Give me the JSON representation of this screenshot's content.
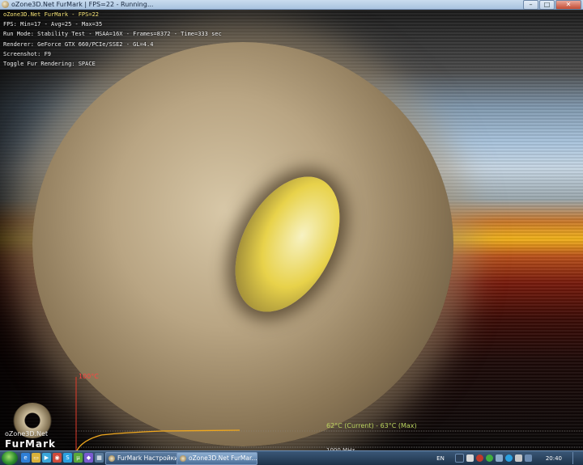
{
  "window": {
    "title": "oZone3D.Net FurMark | FPS=22 - Running...",
    "buttons": {
      "minimize": "–",
      "maximize": "□",
      "close": "✕"
    }
  },
  "stats": {
    "line1": "oZone3D.Net FurMark - FPS=22",
    "line2": "FPS: Min=17 - Avg=25 - Max=35",
    "line3": "Run Mode: Stability Test - MSAA=16X - Frames=8372 - Time=333 sec",
    "line4": "Renderer: GeForce GTX 660/PCIe/SSE2 - GL=4.4",
    "line5": "Screenshot: F9",
    "line6": "Toggle Fur Rendering: SPACE"
  },
  "temperature": {
    "axis_label": "100°C",
    "readout": "62°C (Current) - 63°C (Max)",
    "clock_readout": "1000 MHz",
    "current_c": 62,
    "max_c": 63,
    "line_color": "#f0a81e",
    "axis_color": "#e03a2a"
  },
  "logo": {
    "line1": "oZone3D.Net",
    "line2": "FurMark"
  },
  "taskbar": {
    "quick_launch": [
      {
        "icon": "ie-icon",
        "glyph": "e",
        "color": "#2f7fd6"
      },
      {
        "icon": "folder-icon",
        "glyph": "▭",
        "color": "#d9b13a"
      },
      {
        "icon": "media-player-icon",
        "glyph": "▶",
        "color": "#3aa6d9"
      },
      {
        "icon": "chrome-icon",
        "glyph": "◉",
        "color": "#d04a3a"
      },
      {
        "icon": "skype-icon",
        "glyph": "S",
        "color": "#2aa0e0"
      },
      {
        "icon": "utorrent-icon",
        "glyph": "µ",
        "color": "#5aa83a"
      },
      {
        "icon": "app-icon",
        "glyph": "◆",
        "color": "#7a5ad0"
      },
      {
        "icon": "calculator-icon",
        "glyph": "▦",
        "color": "#5a7a9a"
      },
      {
        "icon": "monitor-icon",
        "glyph": "▣",
        "color": "#3a6aa0"
      },
      {
        "icon": "settings-icon",
        "glyph": "⚙",
        "color": "#888888"
      }
    ],
    "tasks": [
      {
        "label": "FurMark Настройки",
        "active": false
      },
      {
        "label": "oZone3D.Net FurMar...",
        "active": true
      }
    ],
    "language": "EN",
    "clock": "20:40"
  }
}
